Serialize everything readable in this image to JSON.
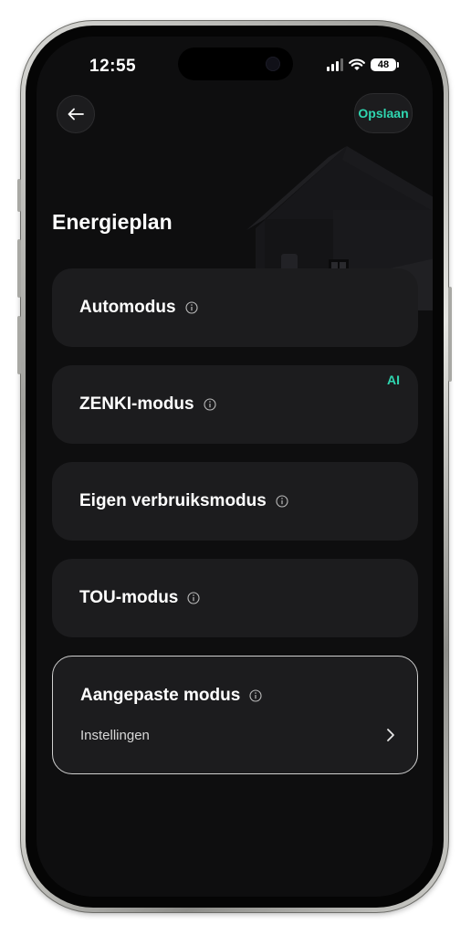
{
  "status_bar": {
    "time": "12:55",
    "battery": "48"
  },
  "header": {
    "save_label": "Opslaan"
  },
  "page": {
    "title": "Energieplan"
  },
  "modes": [
    {
      "label": "Automodus"
    },
    {
      "label": "ZENKI-modus",
      "badge": "AI"
    },
    {
      "label": "Eigen verbruiksmodus"
    },
    {
      "label": "TOU-modus"
    }
  ],
  "custom_mode": {
    "label": "Aangepaste modus",
    "settings_label": "Instellingen"
  },
  "colors": {
    "accent": "#2fd6b0",
    "background": "#0e0e0f",
    "card": "#1c1c1e"
  },
  "icons": {
    "back": "arrow-left-icon",
    "info": "info-icon",
    "chevron": "chevron-right-icon"
  }
}
